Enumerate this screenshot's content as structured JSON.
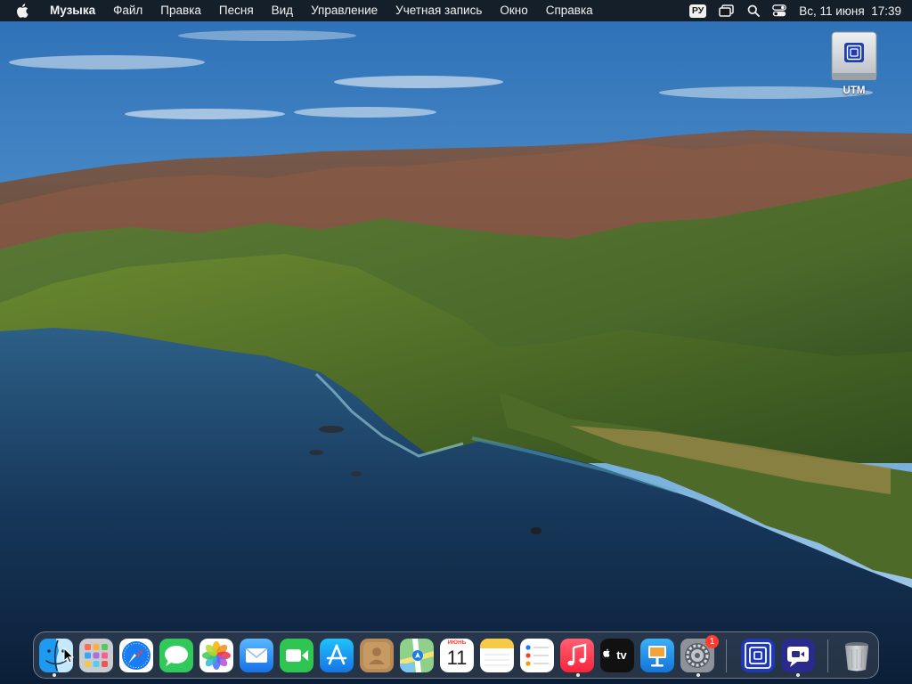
{
  "menubar": {
    "app_name": "Музыка",
    "items": [
      {
        "id": "file",
        "label": "Файл"
      },
      {
        "id": "edit",
        "label": "Правка"
      },
      {
        "id": "song",
        "label": "Песня"
      },
      {
        "id": "view",
        "label": "Вид"
      },
      {
        "id": "controls",
        "label": "Управление"
      },
      {
        "id": "account",
        "label": "Учетная запись"
      },
      {
        "id": "window",
        "label": "Окно"
      },
      {
        "id": "help",
        "label": "Справка"
      }
    ],
    "status": {
      "input_source": "РУ",
      "clock": "Вс, 11 июня  17:39"
    }
  },
  "desktop": {
    "icons": [
      {
        "label": "UTM",
        "icon": "drive-icon"
      }
    ]
  },
  "dock": {
    "items": [
      {
        "name": "finder",
        "icon": "finder-icon",
        "running": true
      },
      {
        "name": "launchpad",
        "icon": "launchpad-icon",
        "running": false
      },
      {
        "name": "safari",
        "icon": "safari-icon",
        "running": false
      },
      {
        "name": "messages",
        "icon": "messages-icon",
        "running": false
      },
      {
        "name": "photos",
        "icon": "photos-icon",
        "running": false
      },
      {
        "name": "mail",
        "icon": "mail-icon",
        "running": false
      },
      {
        "name": "facetime",
        "icon": "facetime-icon",
        "running": false
      },
      {
        "name": "app-store",
        "icon": "app-store-icon",
        "running": false
      },
      {
        "name": "contacts",
        "icon": "contacts-icon",
        "running": false
      },
      {
        "name": "maps",
        "icon": "maps-icon",
        "running": false
      },
      {
        "name": "calendar",
        "icon": "calendar-icon",
        "running": false,
        "month": "ИЮНЬ",
        "day": "11"
      },
      {
        "name": "notes",
        "icon": "notes-icon",
        "running": false
      },
      {
        "name": "reminders",
        "icon": "reminders-icon",
        "running": false
      },
      {
        "name": "music",
        "icon": "music-icon",
        "running": true
      },
      {
        "name": "apple-tv",
        "icon": "apple-tv-icon",
        "running": false,
        "label": "tv"
      },
      {
        "name": "keynote",
        "icon": "keynote-icon",
        "running": false
      },
      {
        "name": "system-settings",
        "icon": "gear-icon",
        "running": true,
        "badge": "1"
      },
      {
        "name": "utm",
        "icon": "utm-icon",
        "running": false
      },
      {
        "name": "screen-share",
        "icon": "screen-share-icon",
        "running": true
      },
      {
        "name": "trash",
        "icon": "trash-icon",
        "running": false
      }
    ]
  },
  "colors": {
    "menubar_bg": "#14181e",
    "menubar_text": "#f2f2f2",
    "badge_red": "#ff3b30",
    "accent_blue": "#1a7cf2"
  }
}
